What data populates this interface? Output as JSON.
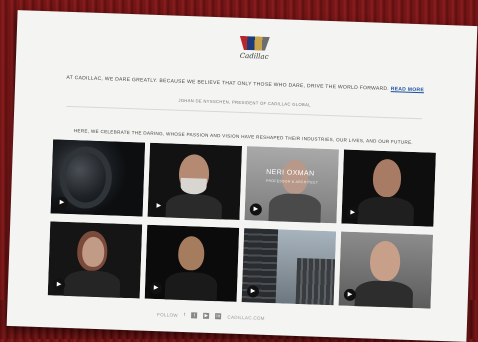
{
  "logo": {
    "brand": "Cadillac"
  },
  "quote": {
    "text": "AT CADILLAC, WE DARE GREATLY. BECAUSE WE BELIEVE THAT ONLY THOSE WHO DARE, DRIVE THE WORLD FORWARD.",
    "more_link": "READ MORE"
  },
  "author": "JOHAN DE NYSSCHEN, PRESIDENT OF CADILLAC GLOBAL",
  "intro": "HERE, WE CELEBRATE THE DARING, WHOSE PASSION AND VISION HAVE RESHAPED THEIR INDUSTRIES, OUR LIVES, AND OUR FUTURE.",
  "tiles": [
    {
      "icon": "play-icon"
    },
    {
      "icon": "play-icon"
    },
    {
      "icon": "play-icon",
      "overlay_name": "NERI OXMAN",
      "overlay_sub": "PROFESSOR & ARCHITECT"
    },
    {
      "icon": "play-icon"
    },
    {
      "icon": "play-icon"
    },
    {
      "icon": "play-icon"
    },
    {
      "icon": "play-icon"
    },
    {
      "icon": "play-icon"
    }
  ],
  "footer": {
    "follow": "FOLLOW",
    "site": "CADILLAC.COM",
    "icons": [
      "facebook-icon",
      "twitter-icon",
      "youtube-icon",
      "linkedin-icon"
    ]
  }
}
